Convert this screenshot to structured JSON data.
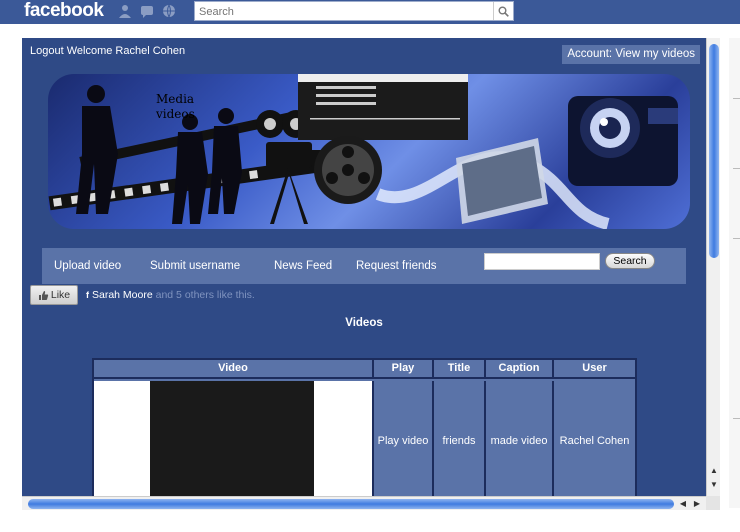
{
  "fb": {
    "logo": "facebook",
    "search_placeholder": "Search",
    "icons": [
      "friends-icon",
      "messages-icon",
      "notifications-icon"
    ]
  },
  "app": {
    "logout_welcome": "Logout Welcome Rachel Cohen",
    "account_link": "Account: View my videos",
    "banner_label_line1": "Media",
    "banner_label_line2": "videos",
    "nav": {
      "upload": "Upload video",
      "submit": "Submit username",
      "news": "News Feed",
      "request": "Request friends",
      "search_button": "Search",
      "search_value": ""
    },
    "like": {
      "button": "Like",
      "name": "Sarah Moore",
      "rest": " and 5 others like this."
    },
    "section_title": "Videos",
    "table": {
      "headers": [
        "Video",
        "Play",
        "Title",
        "Caption",
        "User"
      ],
      "row": {
        "play": "Play video",
        "title": "friends",
        "caption": "made video",
        "user": "Rachel Cohen"
      }
    }
  },
  "colors": {
    "fb_blue": "#3b5998",
    "app_bg": "#2f4a86",
    "nav_bg": "#5a73a8",
    "scroll_thumb": "#3f7be0"
  }
}
